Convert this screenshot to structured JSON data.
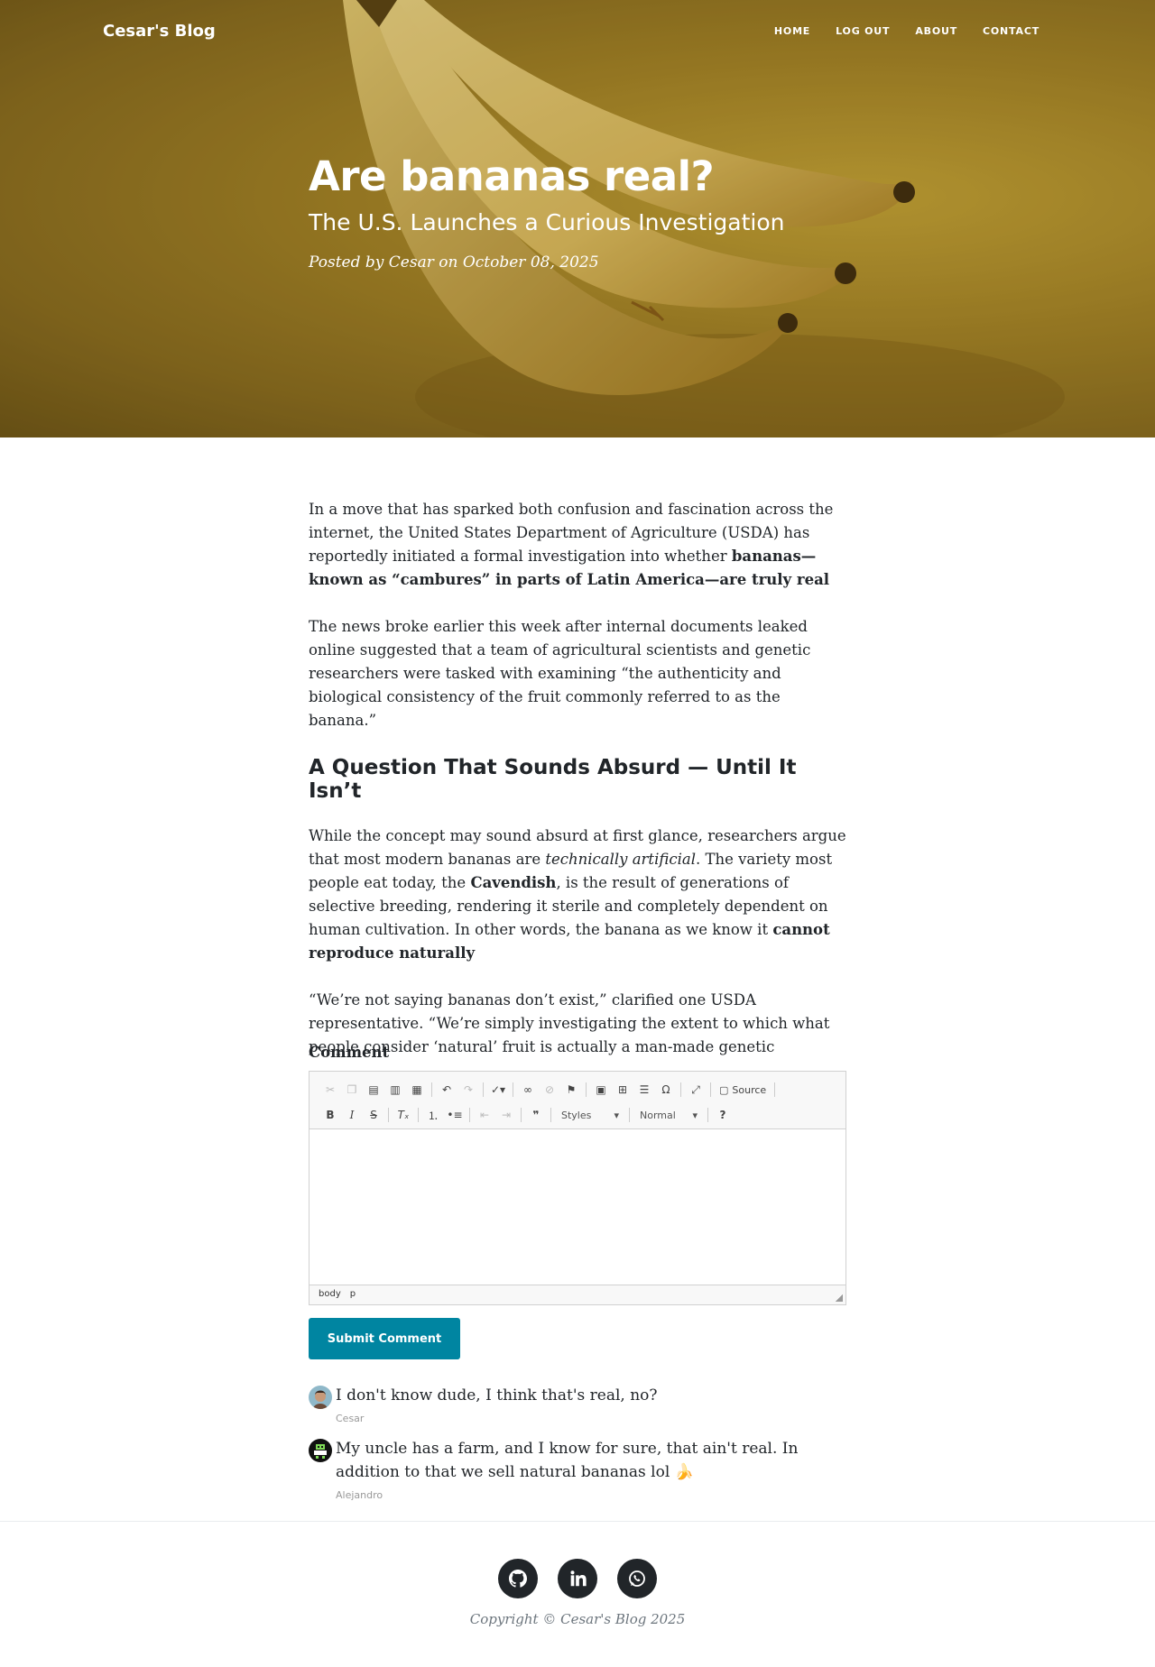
{
  "nav": {
    "brand": "Cesar's Blog",
    "links": [
      "Home",
      "Log Out",
      "About",
      "Contact"
    ]
  },
  "post": {
    "title": "Are bananas real?",
    "subtitle": "The U.S. Launches a Curious Investigation",
    "meta": "Posted by Cesar on October 08, 2025",
    "p1_a": "In a move that has sparked both confusion and fascination across the internet, the United States Department of Agriculture (USDA) has reportedly initiated a formal investigation into whether ",
    "p1_b": "bananas—known as “cambures” in parts of Latin America—are truly real",
    "p2": "The news broke earlier this week after internal documents leaked online suggested that  a team of agricultural scientists and genetic researchers were tasked with examining “the authenticity and biological consistency of the fruit commonly referred to as the banana.”",
    "h3": "A Question That Sounds Absurd — Until It Isn’t",
    "p3_a": "While the concept may sound absurd at first glance, researchers argue that  most modern bananas are ",
    "p3_b": "technically artificial",
    "p3_c": ". The variety most people eat today, the ",
    "p3_d": "Cavendish",
    "p3_e": ", is the result of generations of selective breeding, rendering it sterile and completely dependent on human cultivation. In other words, the banana as we know it ",
    "p3_f": "cannot reproduce naturally",
    "p4": " “We’re not saying bananas don’t exist,” clarified one USDA representative. “We’re simply investigating the extent to which what people consider ‘natural’ fruit is actually a man-made genetic construct.”"
  },
  "comment_form": {
    "label": "Comment",
    "source_label": "Source",
    "styles_label": "Styles",
    "format_label": "Normal",
    "path_body": "body",
    "path_p": "p",
    "submit_label": "Submit Comment"
  },
  "comments": [
    {
      "text": "I don't know dude, I think that's real, no?",
      "author": "Cesar"
    },
    {
      "text": "My uncle has a farm, and I know for sure, that ain't real. In addition to that we sell natural bananas lol 🍌",
      "author": "Alejandro"
    }
  ],
  "footer": {
    "social": [
      "github-icon",
      "linkedin-icon",
      "whatsapp-icon"
    ],
    "copyright": "Copyright © Cesar's Blog 2025"
  },
  "colors": {
    "accent": "#0085a1",
    "text": "#212529",
    "muted": "#6c757d"
  }
}
